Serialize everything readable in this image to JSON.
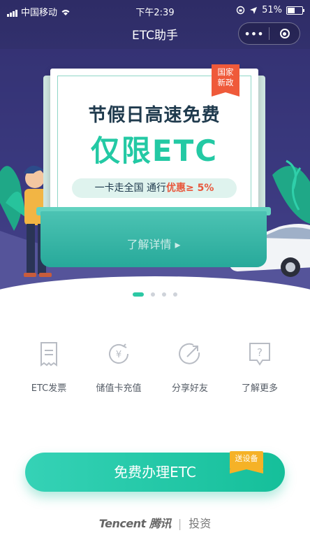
{
  "status_bar": {
    "carrier": "中国移动",
    "time": "下午2:39",
    "battery_percent": "51%",
    "icons": [
      "signal-icon",
      "wifi-icon",
      "lock-rotation-icon",
      "location-arrow-icon",
      "battery-icon"
    ]
  },
  "navbar": {
    "title": "ETC助手",
    "more_glyph": "•••",
    "icons": [
      "more-icon",
      "close-miniprogram-icon"
    ]
  },
  "banner": {
    "badge": [
      "国家",
      "新政"
    ],
    "headline": "节假日高速免费",
    "headline_big": "仅限ETC",
    "pill_prefix": "一卡走全国  通行",
    "pill_highlight": "优惠≥ 5%",
    "button_label": "了解详情 ▸",
    "active_slide": 1,
    "slide_count": 4,
    "colors": {
      "accent": "#23c9a4",
      "dark_blue": "#2e2c66",
      "highlight": "#e8573c"
    }
  },
  "quick_actions": [
    {
      "label": "ETC发票",
      "icon": "receipt-icon"
    },
    {
      "label": "储值卡充值",
      "icon": "yen-recharge-icon"
    },
    {
      "label": "分享好友",
      "icon": "share-icon"
    },
    {
      "label": "了解更多",
      "icon": "help-icon"
    }
  ],
  "cta": {
    "label": "免费办理ETC",
    "badge": "送设备"
  },
  "footer": {
    "brand": "Tencent 腾讯",
    "section": "投资"
  }
}
